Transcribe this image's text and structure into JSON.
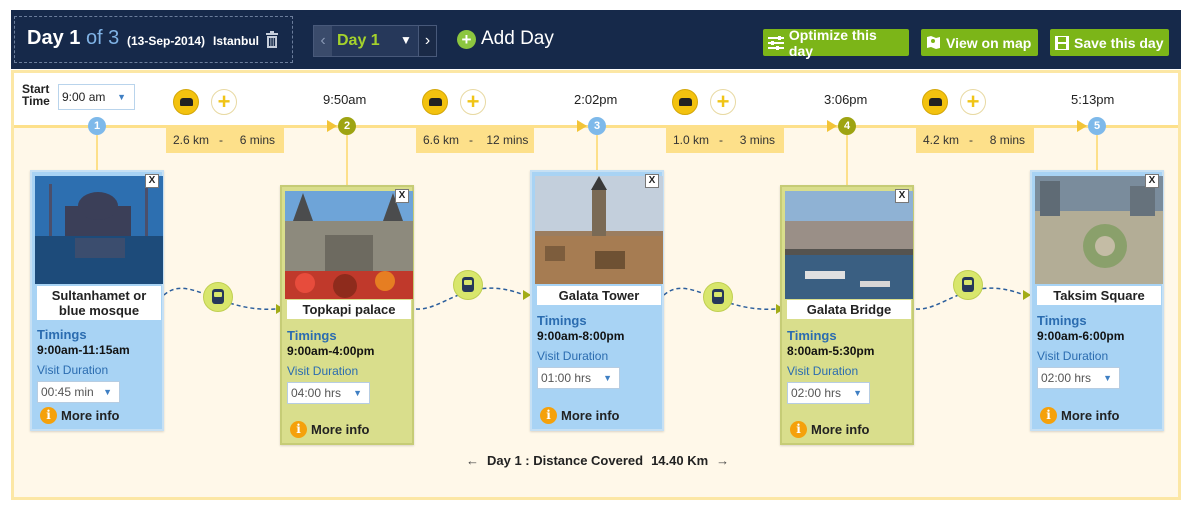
{
  "header": {
    "day_label": "Day 1",
    "of_label": "of 3",
    "date": "(13-Sep-2014)",
    "city": "Istanbul",
    "day_select": "Day 1",
    "add_day": "Add Day",
    "buttons": {
      "optimize": "Optimize this day",
      "view_map": "View on map",
      "save": "Save this day"
    }
  },
  "start": {
    "label_line1": "Start",
    "label_line2": "Time",
    "value": "9:00 am"
  },
  "times": [
    "9:50am",
    "2:02pm",
    "3:06pm",
    "5:13pm"
  ],
  "legs": [
    {
      "km": "2.6 km",
      "sep": "-",
      "mins": "6 mins"
    },
    {
      "km": "6.6 km",
      "sep": "-",
      "mins": "12 mins"
    },
    {
      "km": "1.0 km",
      "sep": "-",
      "mins": "3 mins"
    },
    {
      "km": "4.2 km",
      "sep": "-",
      "mins": "8 mins"
    }
  ],
  "stops": [
    {
      "num": "1",
      "name": "Sultanhamet or blue mosque",
      "timings_label": "Timings",
      "timings": "9:00am-11:15am",
      "vd_label": "Visit Duration",
      "duration": "00:45 min",
      "more": "More info",
      "close": "X"
    },
    {
      "num": "2",
      "name": "Topkapi palace",
      "timings_label": "Timings",
      "timings": "9:00am-4:00pm",
      "vd_label": "Visit Duration",
      "duration": "04:00 hrs",
      "more": "More info",
      "close": "X"
    },
    {
      "num": "3",
      "name": "Galata Tower",
      "timings_label": "Timings",
      "timings": "9:00am-8:00pm",
      "vd_label": "Visit Duration",
      "duration": "01:00 hrs",
      "more": "More info",
      "close": "X"
    },
    {
      "num": "4",
      "name": "Galata Bridge",
      "timings_label": "Timings",
      "timings": "8:00am-5:30pm",
      "vd_label": "Visit Duration",
      "duration": "02:00 hrs",
      "more": "More info",
      "close": "X"
    },
    {
      "num": "5",
      "name": "Taksim Square",
      "timings_label": "Timings",
      "timings": "9:00am-6:00pm",
      "vd_label": "Visit Duration",
      "duration": "02:00 hrs",
      "more": "More info",
      "close": "X"
    }
  ],
  "footer": {
    "left_arrow": "←",
    "label": "Day 1 : Distance Covered",
    "value": "14.40 Km",
    "right_arrow": "→"
  },
  "colors": {
    "navy": "#16294a",
    "green": "#7cb518",
    "blue_card": "#a8d3f4",
    "green_card": "#d9de8c"
  }
}
